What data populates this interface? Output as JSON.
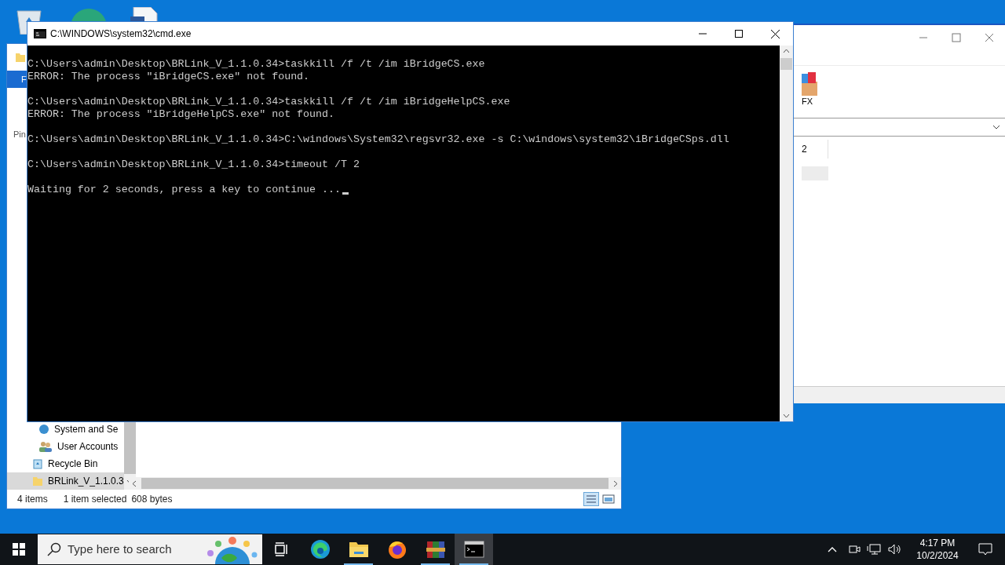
{
  "explorer": {
    "ribbon_tab": "F",
    "pin_label": "Pin",
    "nav_items": [
      {
        "label": "System and Se",
        "selected": false
      },
      {
        "label": "User Accounts",
        "selected": false
      },
      {
        "label": "Recycle Bin",
        "selected": false
      },
      {
        "label": "BRLink_V_1.1.0.3",
        "selected": true
      }
    ],
    "status_bar": [
      "4 items",
      "1 item selected",
      "608 bytes"
    ]
  },
  "right_window": {
    "ribbon_label": "FX",
    "column_text": "2"
  },
  "cmd": {
    "title": "C:\\WINDOWS\\system32\\cmd.exe",
    "blocks": [
      [
        "C:\\Users\\admin\\Desktop\\BRLink_V_1.1.0.34>taskkill /f /t /im iBridgeCS.exe",
        "ERROR: The process \"iBridgeCS.exe\" not found."
      ],
      [
        "C:\\Users\\admin\\Desktop\\BRLink_V_1.1.0.34>taskkill /f /t /im iBridgeHelpCS.exe",
        "ERROR: The process \"iBridgeHelpCS.exe\" not found."
      ],
      [
        "C:\\Users\\admin\\Desktop\\BRLink_V_1.1.0.34>C:\\windows\\System32\\regsvr32.exe -s C:\\windows\\system32\\iBridgeCSps.dll"
      ],
      [
        "C:\\Users\\admin\\Desktop\\BRLink_V_1.1.0.34>timeout /T 2"
      ],
      [
        "Waiting for 2 seconds, press a key to continue ..."
      ]
    ]
  },
  "taskbar": {
    "search_placeholder": "Type here to search",
    "apps": [
      {
        "kind": "taskview",
        "active": false
      },
      {
        "kind": "edge",
        "active": false
      },
      {
        "kind": "explorer",
        "active": true
      },
      {
        "kind": "firefox",
        "active": false
      },
      {
        "kind": "winrar",
        "active": true
      },
      {
        "kind": "cmd",
        "active": true
      }
    ],
    "time": "4:17 PM",
    "date": "10/2/2024"
  }
}
